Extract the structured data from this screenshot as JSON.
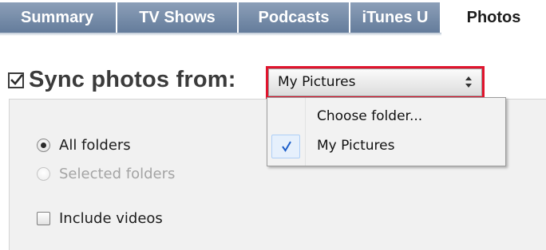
{
  "tabs": [
    {
      "label": "Summary"
    },
    {
      "label": "TV Shows"
    },
    {
      "label": "Podcasts"
    },
    {
      "label": "iTunes U"
    },
    {
      "label": "Photos",
      "active": true
    }
  ],
  "sync": {
    "label": "Sync photos from:",
    "checked": true,
    "source_value": "My Pictures"
  },
  "menu": {
    "items": [
      {
        "label": "Choose folder...",
        "checked": false
      },
      {
        "label": "My Pictures",
        "checked": true
      }
    ]
  },
  "options": {
    "all_folders": {
      "label": "All folders",
      "selected": true
    },
    "selected_folders": {
      "label": "Selected folders",
      "selected": false,
      "enabled": false
    },
    "include_videos": {
      "label": "Include videos",
      "checked": false
    }
  },
  "colors": {
    "tab_gradient_top": "#8c9fb8",
    "tab_gradient_bottom": "#647c9b",
    "highlight_border": "#e0142d",
    "panel_bg": "#f1f1f1",
    "menu_check_bg": "#e6f0fc",
    "check_blue": "#1c5ec9"
  }
}
